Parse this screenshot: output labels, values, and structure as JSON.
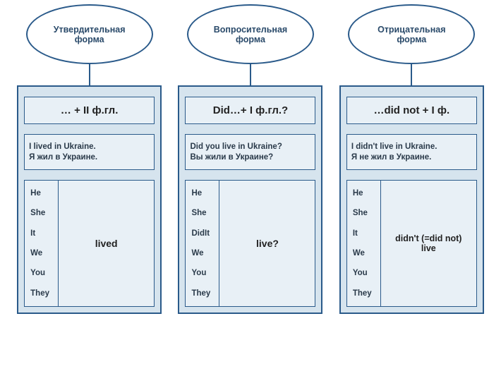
{
  "columns": [
    {
      "title_line1": "Утвердительная",
      "title_line2": "форма",
      "formula": "… + II ф.гл.",
      "example_en": "I lived in Ukraine.",
      "example_ru": "Я жил в Украине.",
      "pronouns": [
        "He",
        "She",
        "It",
        "We",
        "You",
        "They"
      ],
      "verb_line1": "lived",
      "verb_line2": ""
    },
    {
      "title_line1": "Вопросительная",
      "title_line2": "форма",
      "formula": "Did…+ I ф.гл.?",
      "example_en": "Did you live in Ukraine?",
      "example_ru": "Вы жили в Украине?",
      "pronouns": [
        "He",
        "She",
        "DidIt",
        "We",
        "You",
        "They"
      ],
      "verb_line1": "live?",
      "verb_line2": ""
    },
    {
      "title_line1": "Отрицательная",
      "title_line2": "форма",
      "formula": "…did not + I ф.",
      "example_en": "I didn't live in Ukraine.",
      "example_ru": "Я не жил в Украине.",
      "pronouns": [
        "He",
        "She",
        "It",
        "We",
        "You",
        "They"
      ],
      "verb_line1": "didn't (=did not)",
      "verb_line2": "live"
    }
  ]
}
